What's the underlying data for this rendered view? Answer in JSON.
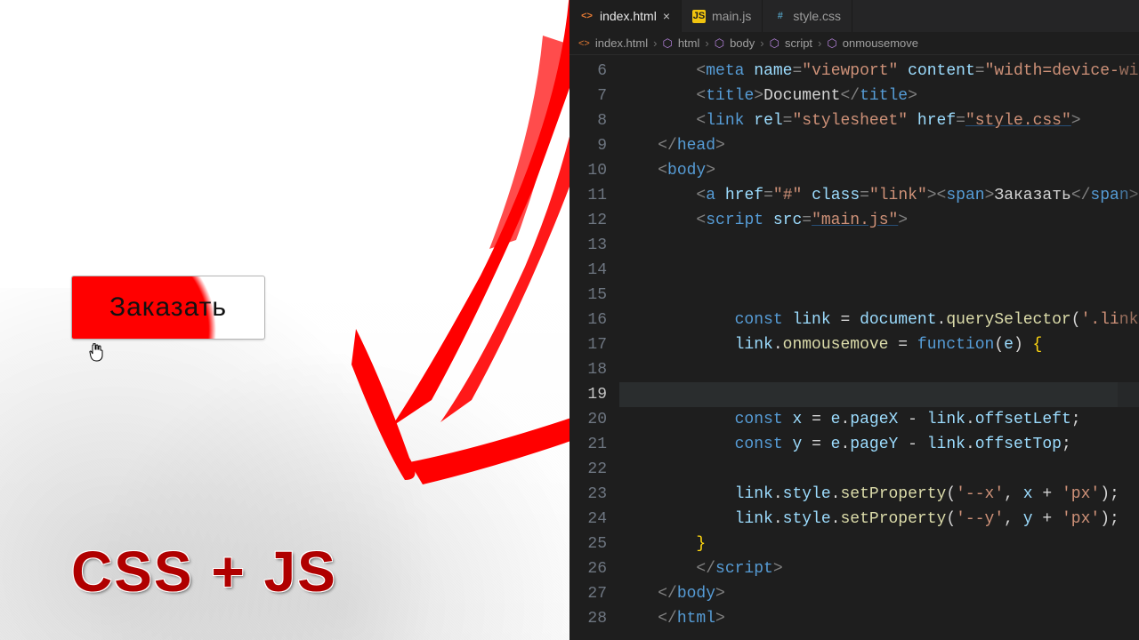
{
  "preview": {
    "button_label": "Заказать",
    "tagline": "CSS + JS"
  },
  "editor": {
    "tabs": [
      {
        "icon": "html",
        "label": "index.html",
        "active": true,
        "closable": true
      },
      {
        "icon": "js",
        "label": "main.js",
        "active": false,
        "closable": false
      },
      {
        "icon": "css",
        "label": "style.css",
        "active": false,
        "closable": false
      }
    ],
    "breadcrumbs": [
      "index.html",
      "html",
      "body",
      "script",
      "onmousemove"
    ],
    "line_start": 6,
    "current_line": 19,
    "lines": {
      "6": {
        "indent": 2,
        "tokens": [
          [
            "pun",
            "<"
          ],
          [
            "tag",
            "meta"
          ],
          [
            "txt",
            " "
          ],
          [
            "attr",
            "name"
          ],
          [
            "pun",
            "="
          ],
          [
            "str",
            "\"viewport\""
          ],
          [
            "txt",
            " "
          ],
          [
            "attr",
            "content"
          ],
          [
            "pun",
            "="
          ],
          [
            "str",
            "\"width=device-width, initial-"
          ]
        ]
      },
      "7": {
        "indent": 2,
        "tokens": [
          [
            "pun",
            "<"
          ],
          [
            "tag",
            "title"
          ],
          [
            "pun",
            ">"
          ],
          [
            "txt",
            "Document"
          ],
          [
            "pun",
            "</"
          ],
          [
            "tag",
            "title"
          ],
          [
            "pun",
            ">"
          ]
        ]
      },
      "8": {
        "indent": 2,
        "tokens": [
          [
            "pun",
            "<"
          ],
          [
            "tag",
            "link"
          ],
          [
            "txt",
            " "
          ],
          [
            "attr",
            "rel"
          ],
          [
            "pun",
            "="
          ],
          [
            "str",
            "\"stylesheet\""
          ],
          [
            "txt",
            " "
          ],
          [
            "attr",
            "href"
          ],
          [
            "pun",
            "="
          ],
          [
            "str_u",
            "\"style.css\""
          ],
          [
            "pun",
            ">"
          ]
        ]
      },
      "9": {
        "indent": 1,
        "tokens": [
          [
            "pun",
            "</"
          ],
          [
            "tag",
            "head"
          ],
          [
            "pun",
            ">"
          ]
        ]
      },
      "10": {
        "indent": 1,
        "tokens": [
          [
            "pun",
            "<"
          ],
          [
            "tag",
            "body"
          ],
          [
            "pun",
            ">"
          ]
        ]
      },
      "11": {
        "indent": 2,
        "tokens": [
          [
            "pun",
            "<"
          ],
          [
            "tag",
            "a"
          ],
          [
            "txt",
            " "
          ],
          [
            "attr",
            "href"
          ],
          [
            "pun",
            "="
          ],
          [
            "str",
            "\"#\""
          ],
          [
            "txt",
            " "
          ],
          [
            "attr",
            "class"
          ],
          [
            "pun",
            "="
          ],
          [
            "str",
            "\"link\""
          ],
          [
            "pun",
            "><"
          ],
          [
            "tag",
            "span"
          ],
          [
            "pun",
            ">"
          ],
          [
            "txt",
            "Заказать"
          ],
          [
            "pun",
            "</"
          ],
          [
            "tag",
            "span"
          ],
          [
            "pun",
            "></"
          ],
          [
            "tag",
            "a"
          ],
          [
            "pun",
            ">"
          ]
        ]
      },
      "12": {
        "indent": 2,
        "tokens": [
          [
            "pun",
            "<"
          ],
          [
            "tag",
            "script"
          ],
          [
            "txt",
            " "
          ],
          [
            "attr",
            "src"
          ],
          [
            "pun",
            "="
          ],
          [
            "str_u",
            "\"main.js\""
          ],
          [
            "pun",
            ">"
          ]
        ]
      },
      "13": {
        "indent": 0,
        "tokens": []
      },
      "14": {
        "indent": 0,
        "tokens": []
      },
      "15": {
        "indent": 0,
        "tokens": []
      },
      "16": {
        "indent": 3,
        "tokens": [
          [
            "kw",
            "const"
          ],
          [
            "txt",
            " "
          ],
          [
            "var",
            "link"
          ],
          [
            "txt",
            " = "
          ],
          [
            "var",
            "document"
          ],
          [
            "txt",
            "."
          ],
          [
            "fn",
            "querySelector"
          ],
          [
            "txt",
            "("
          ],
          [
            "str",
            "'.link'"
          ],
          [
            "txt",
            ");"
          ]
        ]
      },
      "17": {
        "indent": 3,
        "tokens": [
          [
            "var",
            "link"
          ],
          [
            "txt",
            "."
          ],
          [
            "fn",
            "onmousemove"
          ],
          [
            "txt",
            " = "
          ],
          [
            "kw",
            "function"
          ],
          [
            "txt",
            "("
          ],
          [
            "var",
            "e"
          ],
          [
            "txt",
            ") "
          ],
          [
            "brace",
            "{"
          ]
        ]
      },
      "18": {
        "indent": 0,
        "tokens": []
      },
      "19": {
        "indent": 0,
        "tokens": []
      },
      "20": {
        "indent": 3,
        "tokens": [
          [
            "kw",
            "const"
          ],
          [
            "txt",
            " "
          ],
          [
            "var",
            "x"
          ],
          [
            "txt",
            " = "
          ],
          [
            "var",
            "e"
          ],
          [
            "txt",
            "."
          ],
          [
            "var",
            "pageX"
          ],
          [
            "txt",
            " - "
          ],
          [
            "var",
            "link"
          ],
          [
            "txt",
            "."
          ],
          [
            "var",
            "offsetLeft"
          ],
          [
            "txt",
            ";"
          ]
        ]
      },
      "21": {
        "indent": 3,
        "tokens": [
          [
            "kw",
            "const"
          ],
          [
            "txt",
            " "
          ],
          [
            "var",
            "y"
          ],
          [
            "txt",
            " = "
          ],
          [
            "var",
            "e"
          ],
          [
            "txt",
            "."
          ],
          [
            "var",
            "pageY"
          ],
          [
            "txt",
            " - "
          ],
          [
            "var",
            "link"
          ],
          [
            "txt",
            "."
          ],
          [
            "var",
            "offsetTop"
          ],
          [
            "txt",
            ";"
          ]
        ]
      },
      "22": {
        "indent": 0,
        "tokens": []
      },
      "23": {
        "indent": 3,
        "tokens": [
          [
            "var",
            "link"
          ],
          [
            "txt",
            "."
          ],
          [
            "var",
            "style"
          ],
          [
            "txt",
            "."
          ],
          [
            "fn",
            "setProperty"
          ],
          [
            "txt",
            "("
          ],
          [
            "str",
            "'--x'"
          ],
          [
            "txt",
            ", "
          ],
          [
            "var",
            "x"
          ],
          [
            "txt",
            " + "
          ],
          [
            "str",
            "'px'"
          ],
          [
            "txt",
            ");"
          ]
        ]
      },
      "24": {
        "indent": 3,
        "tokens": [
          [
            "var",
            "link"
          ],
          [
            "txt",
            "."
          ],
          [
            "var",
            "style"
          ],
          [
            "txt",
            "."
          ],
          [
            "fn",
            "setProperty"
          ],
          [
            "txt",
            "("
          ],
          [
            "str",
            "'--y'"
          ],
          [
            "txt",
            ", "
          ],
          [
            "var",
            "y"
          ],
          [
            "txt",
            " + "
          ],
          [
            "str",
            "'px'"
          ],
          [
            "txt",
            ");"
          ]
        ]
      },
      "25": {
        "indent": 2,
        "tokens": [
          [
            "brace",
            "}"
          ]
        ]
      },
      "26": {
        "indent": 2,
        "tokens": [
          [
            "pun",
            "</"
          ],
          [
            "tag",
            "script"
          ],
          [
            "pun",
            ">"
          ]
        ]
      },
      "27": {
        "indent": 1,
        "tokens": [
          [
            "pun",
            "</"
          ],
          [
            "tag",
            "body"
          ],
          [
            "pun",
            ">"
          ]
        ]
      },
      "28": {
        "indent": 1,
        "tokens": [
          [
            "pun",
            "</"
          ],
          [
            "tag",
            "html"
          ],
          [
            "pun",
            ">"
          ]
        ]
      }
    }
  }
}
